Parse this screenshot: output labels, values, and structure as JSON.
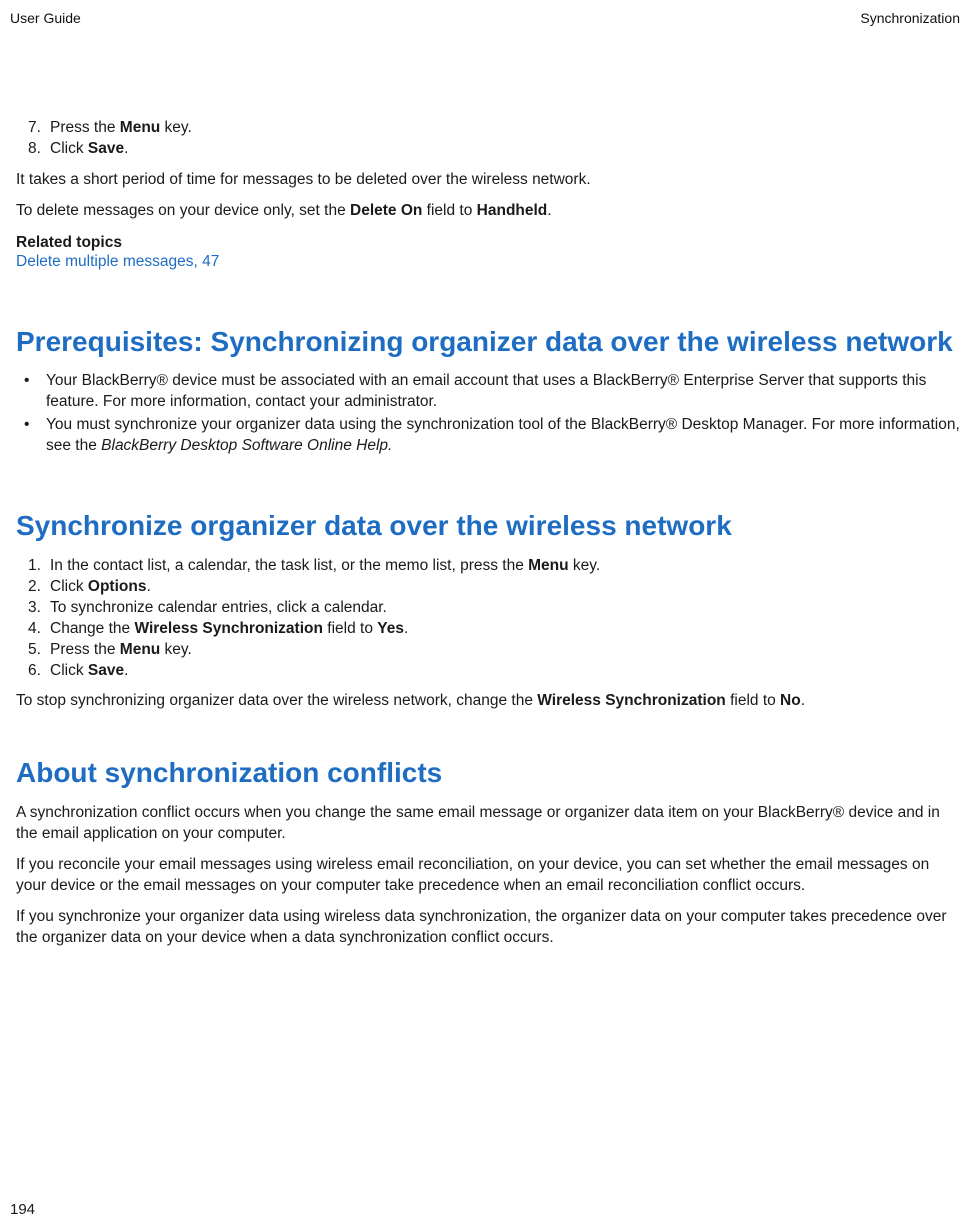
{
  "header": {
    "left": "User Guide",
    "right": "Synchronization"
  },
  "footer": {
    "page_number": "194"
  },
  "intro_steps": [
    {
      "n": "7.",
      "pre": "Press the ",
      "bold": "Menu",
      "post": " key."
    },
    {
      "n": "8.",
      "pre": "Click ",
      "bold": "Save",
      "post": "."
    }
  ],
  "intro_para1": {
    "text": "It takes a short period of time for messages to be deleted over the wireless network."
  },
  "intro_para2": {
    "pre": "To delete messages on your device only, set the ",
    "b1": "Delete On",
    "mid": " field to ",
    "b2": "Handheld",
    "post": "."
  },
  "related": {
    "label": "Related topics",
    "link": "Delete multiple messages, 47"
  },
  "sec1": {
    "title": "Prerequisites: Synchronizing organizer data over the wireless network",
    "bullets": [
      {
        "text": "Your BlackBerry® device must be associated with an email account that uses a BlackBerry® Enterprise Server that supports this feature. For more information, contact your administrator."
      },
      {
        "pre": "You must synchronize your organizer data using the synchronization tool of the BlackBerry® Desktop Manager. For more information, see the  ",
        "italic": "BlackBerry Desktop Software Online Help.",
        "post": ""
      }
    ]
  },
  "sec2": {
    "title": "Synchronize organizer data over the wireless network",
    "steps": [
      {
        "n": "1.",
        "pre": "In the contact list, a calendar, the task list, or the memo list, press the ",
        "bold": "Menu",
        "post": " key."
      },
      {
        "n": "2.",
        "pre": "Click ",
        "bold": "Options",
        "post": "."
      },
      {
        "n": "3.",
        "pre": "To synchronize calendar entries, click a calendar.",
        "bold": "",
        "post": ""
      },
      {
        "n": "4.",
        "pre": "Change the ",
        "bold": "Wireless Synchronization",
        "mid": " field to ",
        "bold2": "Yes",
        "post": "."
      },
      {
        "n": "5.",
        "pre": "Press the ",
        "bold": "Menu",
        "post": " key."
      },
      {
        "n": "6.",
        "pre": "Click ",
        "bold": "Save",
        "post": "."
      }
    ],
    "outro": {
      "pre": "To stop synchronizing organizer data over the wireless network, change the ",
      "b1": "Wireless Synchronization",
      "mid": " field to ",
      "b2": "No",
      "post": "."
    }
  },
  "sec3": {
    "title": "About synchronization conflicts",
    "p1": "A synchronization conflict occurs when you change the same email message or organizer data item on your BlackBerry® device and in the email application on your computer.",
    "p2": "If you reconcile your email messages using wireless email reconciliation, on your device, you can set whether the email messages on your device or the email messages on your computer take precedence when an email reconciliation conflict occurs.",
    "p3": "If you synchronize your organizer data using wireless data synchronization, the organizer data on your computer takes precedence over the organizer data on your device when a data synchronization conflict occurs."
  }
}
